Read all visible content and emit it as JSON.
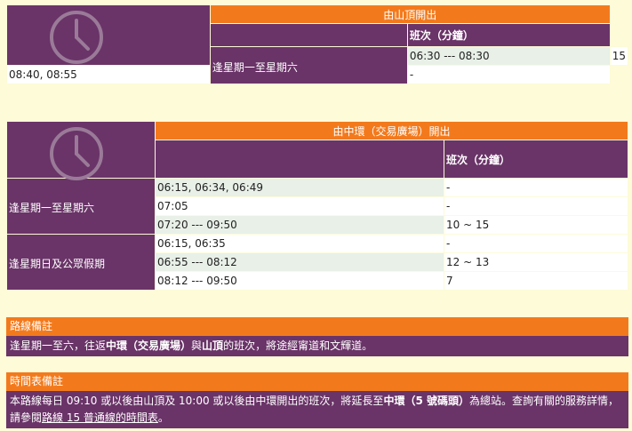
{
  "table1": {
    "header": "由山頂開出",
    "column_label": "班次（分鐘）",
    "day_label": "逢星期一至星期六",
    "rows": [
      {
        "time": "06:30 --- 08:30",
        "freq": "15"
      },
      {
        "time": "08:40, 08:55",
        "freq": "-"
      }
    ]
  },
  "table2": {
    "header": "由中環（交易廣場）開出",
    "column_label": "班次（分鐘）",
    "day_label_1": "逢星期一至星期六",
    "day_label_2": "逢星期日及公眾假期",
    "rows": [
      {
        "time": "06:15, 06:34, 06:49",
        "freq": "-"
      },
      {
        "time": "07:05",
        "freq": "-"
      },
      {
        "time": "07:20 --- 09:50",
        "freq": "10 ~ 15"
      },
      {
        "time": "06:15, 06:35",
        "freq": "-"
      },
      {
        "time": "06:55 --- 08:12",
        "freq": "12 ~ 13"
      },
      {
        "time": "08:12 --- 09:50",
        "freq": "7"
      }
    ]
  },
  "route_note": {
    "title": "路線備註",
    "t1": "逢星期一至六，往返",
    "b1": "中環（交易廣場）",
    "t2": "與",
    "b2": "山頂",
    "t3": "的班次，將途經甯道和文輝道。"
  },
  "timetable_note": {
    "title": "時間表備註",
    "t1": "本路線每日 09:10 或以後由山頂及 10:00 或以後由中環開出的班次，將延長至",
    "b1": "中環（5 號碼頭）",
    "t2": "為總站。查詢有關的服務詳情，請參閱",
    "link": "路線 15 普通線的時間表",
    "t3": "。"
  },
  "colors": {
    "orange": "#f37a1c",
    "purple": "#6a3468",
    "bg": "#fdfbd8"
  },
  "icons": [
    "clock-icon"
  ]
}
